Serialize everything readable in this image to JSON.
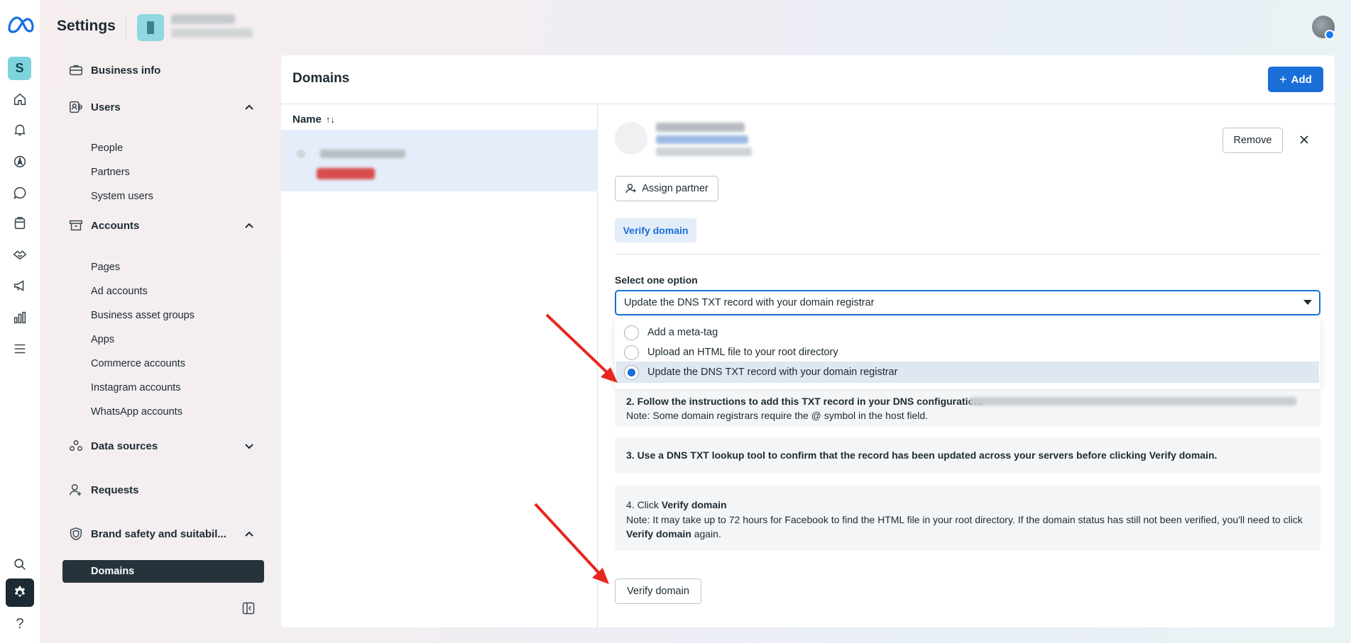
{
  "header": {
    "title": "Settings"
  },
  "rail": {
    "account_initial": "S",
    "help_glyph": "?"
  },
  "nav": {
    "business_info": "Business info",
    "users": "Users",
    "users_items": [
      "People",
      "Partners",
      "System users"
    ],
    "accounts": "Accounts",
    "accounts_items": [
      "Pages",
      "Ad accounts",
      "Business asset groups",
      "Apps",
      "Commerce accounts",
      "Instagram accounts",
      "WhatsApp accounts"
    ],
    "data_sources": "Data sources",
    "requests": "Requests",
    "brand_safety": "Brand safety and suitabil...",
    "active_item": "Domains"
  },
  "panel": {
    "title": "Domains",
    "add_label": "Add",
    "list_header": "Name",
    "sort_glyph": "↑↓"
  },
  "detail": {
    "remove_label": "Remove",
    "assign_partner_label": "Assign partner",
    "verify_tab_label": "Verify domain",
    "select_label": "Select one option",
    "selected_value": "Update the DNS TXT record with your domain registrar",
    "options": [
      {
        "label": "Add a meta-tag",
        "selected": false
      },
      {
        "label": "Upload an HTML file to your root directory",
        "selected": false
      },
      {
        "label": "Update the DNS TXT record with your domain registrar",
        "selected": true
      }
    ],
    "step2_line1": "2. Follow the instructions to add this TXT record in your DNS configuration:",
    "step2_line2": "Note: Some domain registrars require the @ symbol in the host field.",
    "step3": "3. Use a DNS TXT lookup tool to confirm that the record has been updated across your servers before clicking Verify domain.",
    "step4_prefix": "4. Click ",
    "step4_bold": "Verify domain",
    "step4_note_a": "Note: It may take up to 72 hours for Facebook to find the HTML file in your root directory. If the domain status has still not been verified, you'll need to click ",
    "step4_note_bold": "Verify domain",
    "step4_note_b": " again.",
    "verify_button_label": "Verify domain"
  },
  "colors": {
    "accent": "#1a6ed8",
    "active_nav": "#26333b",
    "annotation_arrow": "#e8261f"
  }
}
